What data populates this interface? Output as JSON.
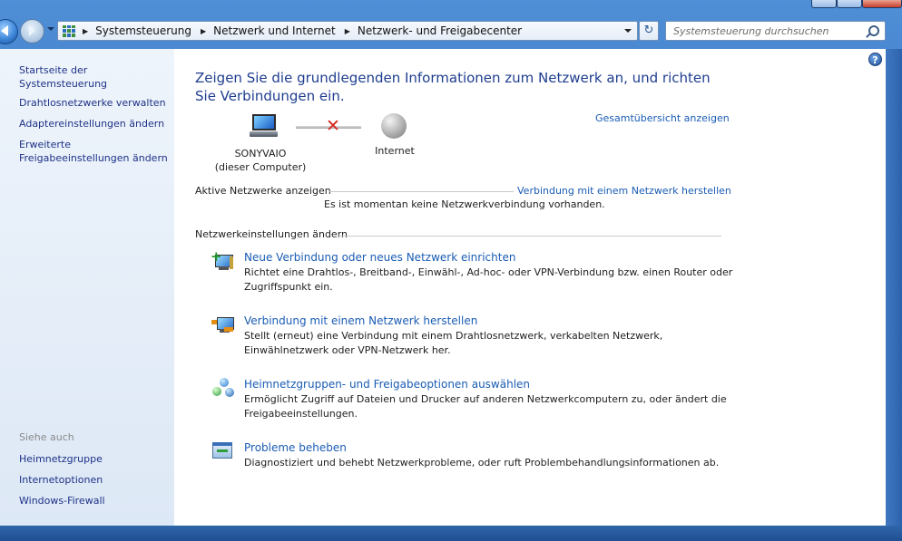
{
  "address": {
    "breadcrumbs": [
      "Systemsteuerung",
      "Netzwerk und Internet",
      "Netzwerk- und Freigabecenter"
    ]
  },
  "search": {
    "placeholder": "Systemsteuerung durchsuchen"
  },
  "sidebar": {
    "home_link": "Startseite der Systemsteuerung",
    "links": [
      "Drahtlosnetzwerke verwalten",
      "Adaptereinstellungen ändern",
      "Erweiterte Freigabeeinstellungen ändern"
    ],
    "see_also_heading": "Siehe auch",
    "see_also": [
      "Heimnetzgruppe",
      "Internetoptionen",
      "Windows-Firewall"
    ]
  },
  "main": {
    "title": "Zeigen Sie die grundlegenden Informationen zum Netzwerk an, und richten Sie Verbindungen ein.",
    "full_map_link": "Gesamtübersicht anzeigen",
    "map": {
      "computer_name": "SONYVAIO",
      "computer_sub": "(dieser Computer)",
      "internet_label": "Internet"
    },
    "active_networks_heading": "Aktive Netzwerke anzeigen",
    "connect_link": "Verbindung mit einem Netzwerk herstellen",
    "no_connection_text": "Es ist momentan keine Netzwerkverbindung vorhanden.",
    "change_settings_heading": "Netzwerkeinstellungen ändern",
    "tasks": [
      {
        "title": "Neue Verbindung oder neues Netzwerk einrichten",
        "description": "Richtet eine Drahtlos-, Breitband-, Einwähl-, Ad-hoc- oder VPN-Verbindung bzw. einen Router oder Zugriffspunkt ein."
      },
      {
        "title": "Verbindung mit einem Netzwerk herstellen",
        "description": "Stellt (erneut) eine Verbindung mit einem Drahtlosnetzwerk, verkabelten Netzwerk, Einwählnetzwerk oder VPN-Netzwerk her."
      },
      {
        "title": "Heimnetzgruppen- und Freigabeoptionen auswählen",
        "description": "Ermöglicht Zugriff auf Dateien und Drucker auf anderen Netzwerkcomputern zu, oder ändert die Freigabeeinstellungen."
      },
      {
        "title": "Probleme beheben",
        "description": "Diagnostiziert und behebt Netzwerkprobleme, oder ruft Problembehandlungsinformationen ab."
      }
    ]
  }
}
